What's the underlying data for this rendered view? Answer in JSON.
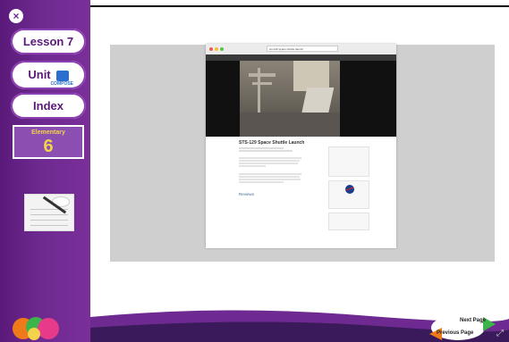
{
  "sidebar": {
    "close_label": "×",
    "lesson_label": "Lesson 7",
    "unit_label": "Unit",
    "unit_sub": "COMPOSE",
    "index_label": "Index",
    "grade_label": "Elementary",
    "grade_number": "6"
  },
  "browser": {
    "url": "sts-129 space shuttle launch",
    "video_title": "STS-129 Space Shuttle Launch",
    "reviews_label": "Reviews"
  },
  "nav": {
    "next_label": "Next Page",
    "prev_label": "Previous Page"
  },
  "colors": {
    "sidebar_purple": "#6e2a90",
    "grade_yellow": "#f3d34a",
    "next_green": "#3bb54a",
    "prev_orange": "#f07a1a"
  }
}
